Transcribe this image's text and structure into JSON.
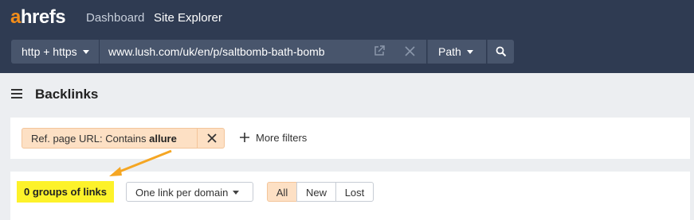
{
  "header": {
    "logo_accent": "a",
    "logo_rest": "hrefs",
    "nav": [
      "Dashboard",
      "Site Explorer"
    ],
    "nav_active_index": 1,
    "protocol_label": "http + https",
    "url_value": "www.lush.com/uk/en/p/saltbomb-bath-bomb",
    "mode_label": "Path",
    "icons": [
      "external-link-icon",
      "close-icon",
      "chevron-down-icon",
      "search-icon"
    ]
  },
  "page": {
    "title": "Backlinks",
    "menu_icon": "hamburger-icon"
  },
  "filters": {
    "chip_prefix": "Ref. page URL: Contains ",
    "chip_value": "allure",
    "more_filters_label": "More filters"
  },
  "results": {
    "groups_label": "0 groups of links",
    "grouping_label": "One link per domain",
    "segments": [
      "All",
      "New",
      "Lost"
    ],
    "active_segment": "All"
  },
  "colors": {
    "header_bg": "#2f3b52",
    "accent": "#f28d1a",
    "chip_bg": "#fde0c4",
    "highlight": "#fdf22a",
    "annotation_arrow": "#f5a623"
  }
}
